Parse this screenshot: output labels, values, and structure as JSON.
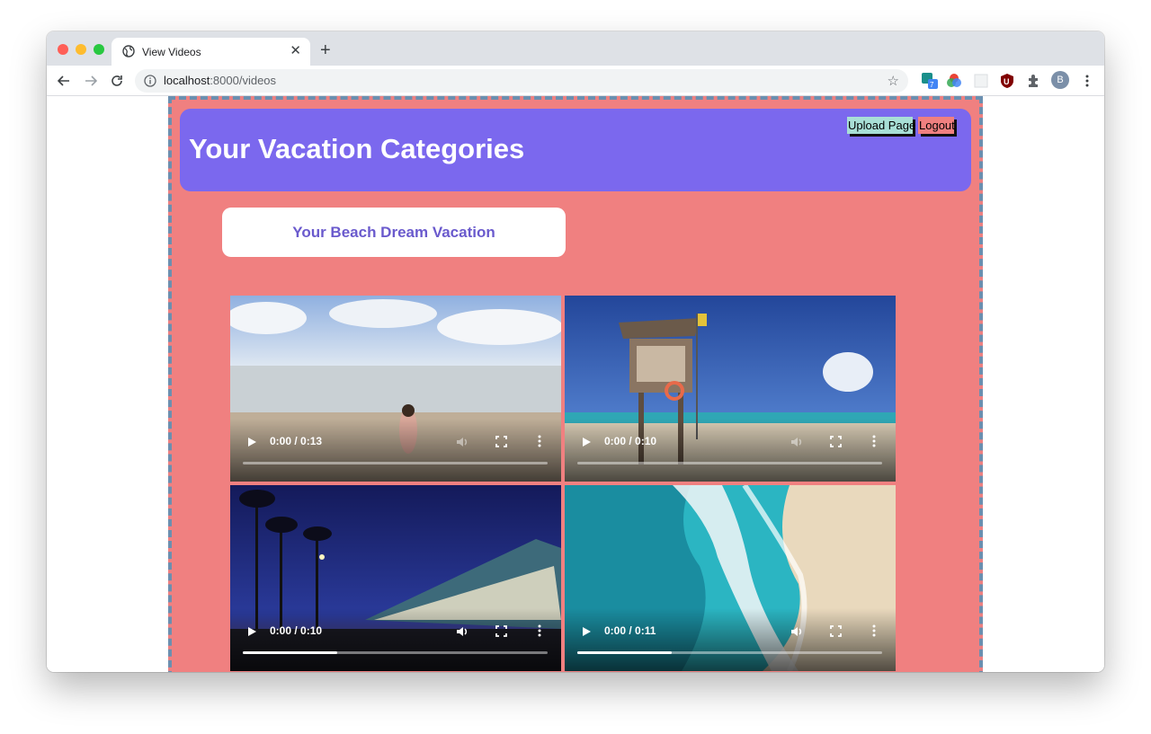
{
  "browser": {
    "tab_title": "View Videos",
    "url_host": "localhost",
    "url_path": ":8000/videos",
    "icons": [
      "globe-icon",
      "close-icon",
      "new-tab-icon",
      "back-icon",
      "forward-icon",
      "reload-icon",
      "info-icon",
      "bookmark-star-icon",
      "extensions-icon",
      "menu-icon"
    ],
    "profile_initial": "B"
  },
  "header": {
    "title": "Your Vacation Categories",
    "upload_label": "Upload Page",
    "logout_label": "Logout"
  },
  "category": {
    "title": "Your Beach Dream Vacation"
  },
  "videos": [
    {
      "time": "0:00 / 0:13",
      "progress": 0,
      "muted": true
    },
    {
      "time": "0:00 / 0:10",
      "progress": 0,
      "muted": true
    },
    {
      "time": "0:00 / 0:10",
      "progress": 0.31,
      "muted": false
    },
    {
      "time": "0:00 / 0:11",
      "progress": 0.31,
      "muted": false
    }
  ],
  "colors": {
    "page_bg": "#f08080",
    "header_bg": "#7b68ee",
    "category_text": "#6a5acd",
    "upload_btn": "#a8dfd6",
    "logout_btn": "#f08080"
  }
}
